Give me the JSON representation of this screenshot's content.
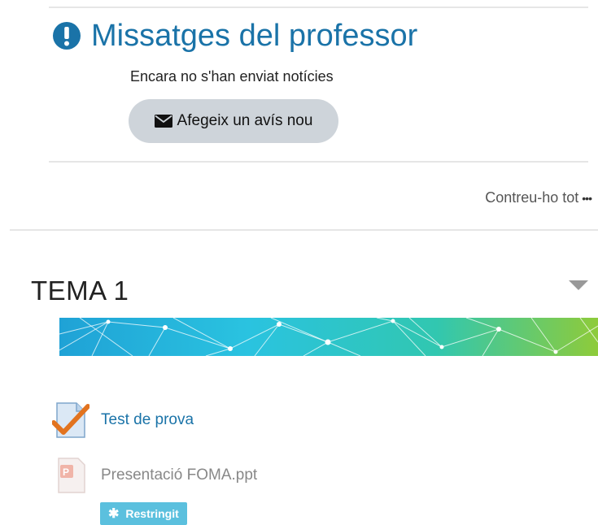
{
  "news": {
    "title": "Missatges del professor",
    "empty_text": "Encara no s'han enviat notícies",
    "add_button_label": "Afegeix un avís nou"
  },
  "toolbar": {
    "collapse_all_label": "Contreu-ho tot",
    "collapse_all_icon": "ellipsis-icon"
  },
  "section": {
    "title": "TEMA 1",
    "activities": [
      {
        "name": "Test de prova",
        "icon": "quiz-icon"
      },
      {
        "name": "Presentació FOMA.ppt",
        "icon": "powerpoint-icon",
        "restriction": "Restringit"
      }
    ]
  },
  "colors": {
    "link": "#1a73a8",
    "button_bg": "#ced4da",
    "badge": "#5bc0de"
  }
}
